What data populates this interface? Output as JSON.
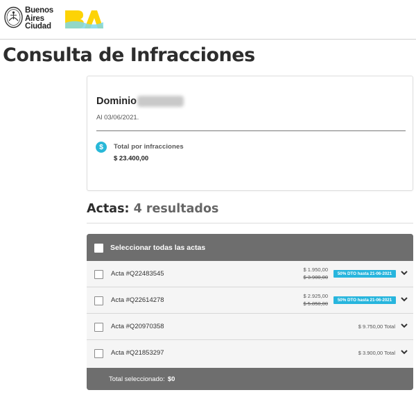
{
  "header": {
    "city_name_lines": [
      "Buenos",
      "Aires",
      "Ciudad"
    ],
    "logo_text": "BA",
    "colors": {
      "logo_yellow": "#FDD306",
      "logo_cyan": "#7FD8EA"
    }
  },
  "page": {
    "title": "Consulta de Infracciones"
  },
  "summary": {
    "dominio_label": "Dominio",
    "date": "Al 03/06/2021.",
    "total_label": "Total por infracciones",
    "total_value": "$ 23.400,00",
    "icon": "dollar-icon"
  },
  "actas": {
    "heading": "Actas:",
    "results": "4 resultados",
    "select_all_label": "Seleccionar todas las actas",
    "rows": [
      {
        "label": "Acta #Q22483545",
        "price": "$ 1.950,00",
        "old_price": "$ 3.900,00",
        "badge": "50% DTO hasta 21-06-2021"
      },
      {
        "label": "Acta #Q22614278",
        "price": "$ 2.925,00",
        "old_price": "$ 5.850,00",
        "badge": "50% DTO hasta 21-06-2021"
      },
      {
        "label": "Acta #Q20970358",
        "total": "$ 9.750,00 Total"
      },
      {
        "label": "Acta #Q21853297",
        "total": "$ 3.900,00 Total"
      }
    ],
    "footer_label": "Total seleccionado:",
    "footer_value": "$0",
    "colors": {
      "badge": "#27B5DD",
      "table_header": "#6E6E6E"
    }
  }
}
